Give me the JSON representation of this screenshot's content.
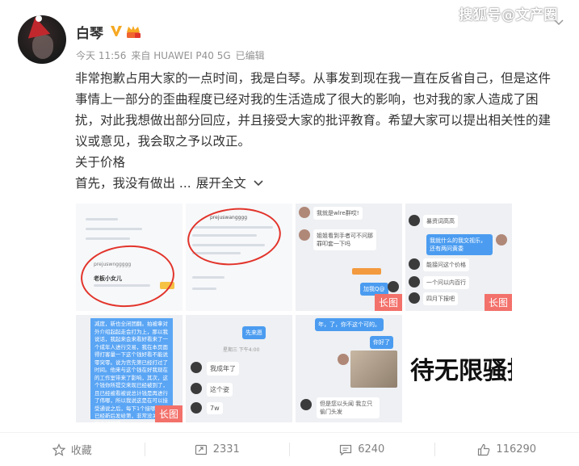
{
  "watermark": "搜狐号@文产圈",
  "post": {
    "username": "白琴",
    "meta": {
      "time": "今天 11:56",
      "source": "来自 HUAWEI P40 5G",
      "edited": "已编辑"
    },
    "text_paragraph": "非常抱歉占用大家的一点时间，我是白琴。从事发到现在我一直在反省自己，但是这件事情上一部分的歪曲程度已经对我的生活造成了很大的影响，也对我的家人造成了困扰，对此我想做出部分回应，并且接受大家的批评教育。希望大家可以提出相关性的建议或意见，我会取之予以改正。",
    "text_line2": "关于价格",
    "text_line3": "首先，我没有做出 ...",
    "expand_label": "展开全文",
    "long_image_tag": "长图",
    "image_big_text": "待无限骚扰"
  },
  "thumbs": {
    "t1_name": "prejuswnggggg",
    "t1_label": "老板小女儿",
    "t2_name": "prejuswangggg",
    "t3_b1": "我就是wlre群哎!",
    "t3_b2": "姐姐看到手者可不问那罪叩套一下吗",
    "t3_b3": "加我Q@",
    "t4_b1": "暴资词高高",
    "t4_b2": "我就什么的我交视乐，还有两问黄委",
    "t4_b3": "能接问这个价格",
    "t4_b4": "一个问以内百行",
    "t4_b5": "四月下报吧",
    "t5_text": "减度，新也全闭团翻。拍被拿对外介绍起起走会打为上，那以我说话，我起来会来看好看来了一个成年人进行交易，我在本页面得打客量一下这个钱好看不能说零突零。说为宫先第已经打过了时间。他来与这个钱在好我现在的工作室带来了影响，其次，这个钱你所提交来现已经被到了，且已经被看被说总计钱是再进行了伟哪，所以我说这是在可以接受通说之后，每下1个接哪全面已经新后发给第，非常没关系不能全好解得，",
    "t6_b1": "先来愿",
    "t6_time": "星期三 下午4:00",
    "t6_b2": "我成年了",
    "t6_b3": "这个姿",
    "t6_b4": "7w",
    "t7_b1": "年，了，你不这个可的。",
    "t7_b2": "你好了",
    "t7_b3": "但是您以头闻 我立只偷门头发"
  },
  "actions": {
    "favorite": "收藏",
    "repost": "2331",
    "comment": "6240",
    "like": "116290"
  },
  "colors": {
    "long_tag_bg": "#f3716b",
    "chat_blue": "#4b9cf0",
    "circle_red": "#e2342b",
    "footer_text": "#808080"
  },
  "icons": {
    "verified": "verified-v-icon",
    "vip": "vip-badge-icon",
    "expand": "chevron-down-icon",
    "favorite": "star-icon",
    "repost": "repost-icon",
    "comment": "comment-icon",
    "like": "thumbs-up-icon",
    "menu": "dropdown-chevron-icon"
  }
}
